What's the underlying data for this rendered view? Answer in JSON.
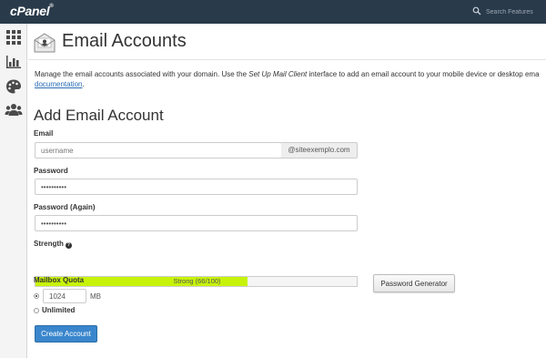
{
  "topbar": {
    "logo": "cPanel",
    "logo_mark": "®",
    "search_placeholder": "Search Features"
  },
  "sidebar": {
    "icons": [
      "grid-icon",
      "stats-icon",
      "palette-icon",
      "users-icon"
    ]
  },
  "header": {
    "icon": "email-accounts-icon",
    "title": "Email Accounts"
  },
  "description": {
    "text1": "Manage the email accounts associated with your domain. Use the ",
    "em": "Set Up Mail Client",
    "text2": " interface to add an email account to your mobile device or desktop ema",
    "link": "documentation",
    "end": "."
  },
  "form": {
    "title": "Add Email Account",
    "email_label": "Email",
    "email_value": "username",
    "domain": "@siteexemplo.com",
    "password_label": "Password",
    "password_value": "••••••••••",
    "password_again_label": "Password (Again)",
    "password_again_value": "••••••••••",
    "strength_label": "Strength",
    "strength_text": "Strong (66/100)",
    "strength_percent": 66,
    "generator_button": "Password Generator",
    "quota_label": "Mailbox Quota",
    "quota_value": "1024",
    "quota_unit": "MB",
    "unlimited_label": "Unlimited",
    "create_button": "Create Account"
  },
  "colors": {
    "topbar": "#293a4a",
    "accent": "#3a86cc",
    "strength_fill": "#c7f30a"
  }
}
